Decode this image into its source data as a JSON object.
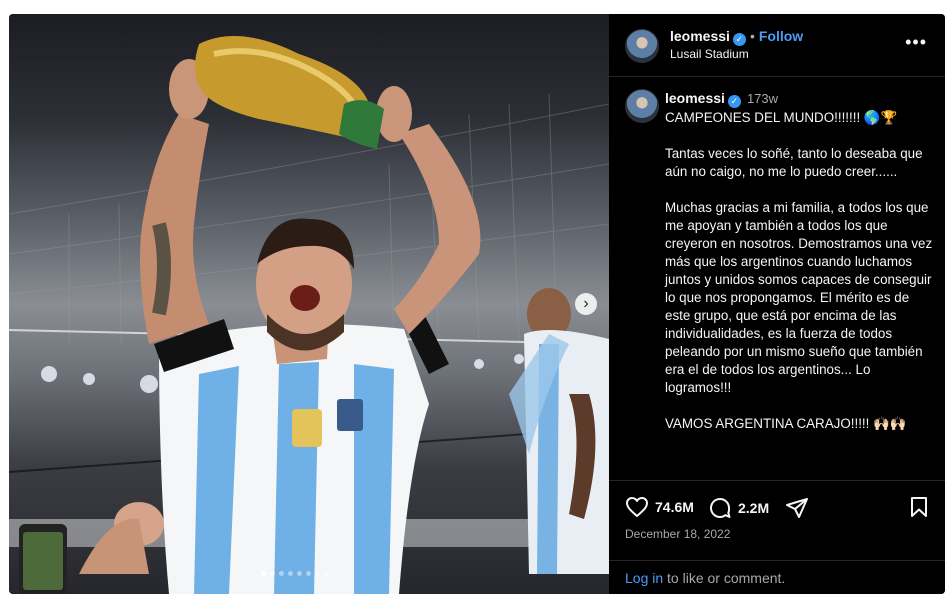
{
  "post": {
    "username": "leomessi",
    "follow_label": "Follow",
    "separator": "•",
    "location": "Lusail Stadium",
    "more_label": "•••",
    "time_ago": "173w",
    "caption": "CAMPEONES DEL MUNDO!!!!!!! 🌎🏆\n\nTantas veces lo soñé, tanto lo deseaba que aún no caigo, no me lo puedo creer......\n\nMuchas gracias a mi familia, a todos los que me apoyan y también a todos los que creyeron en nosotros. Demostramos una vez más que los argentinos cuando luchamos juntos y unidos somos capaces de conseguir lo que nos propongamos. El mérito es de este grupo, que está por encima de las individualidades, es la fuerza de todos peleando por un mismo sueño que también era el de todos los argentinos... Lo logramos!!!\n\nVAMOS ARGENTINA CARAJO!!!!! 🙌🏻🙌🏻",
    "likes": "74.6M",
    "comments": "2.2M",
    "date": "December 18, 2022",
    "login_link": "Log in",
    "login_text": " to like or comment.",
    "carousel": {
      "total": 8,
      "active_index": 0,
      "next_symbol": "›"
    }
  },
  "icons": {
    "verified": "verified-badge-icon",
    "like": "heart-icon",
    "comment": "comment-bubble-icon",
    "share": "share-paper-plane-icon",
    "save": "bookmark-icon",
    "more": "more-options-icon",
    "next": "chevron-right-icon"
  },
  "colors": {
    "background": "#000000",
    "link": "#4a9cf6",
    "muted": "#a8a8a8",
    "verified": "#3897f0"
  }
}
